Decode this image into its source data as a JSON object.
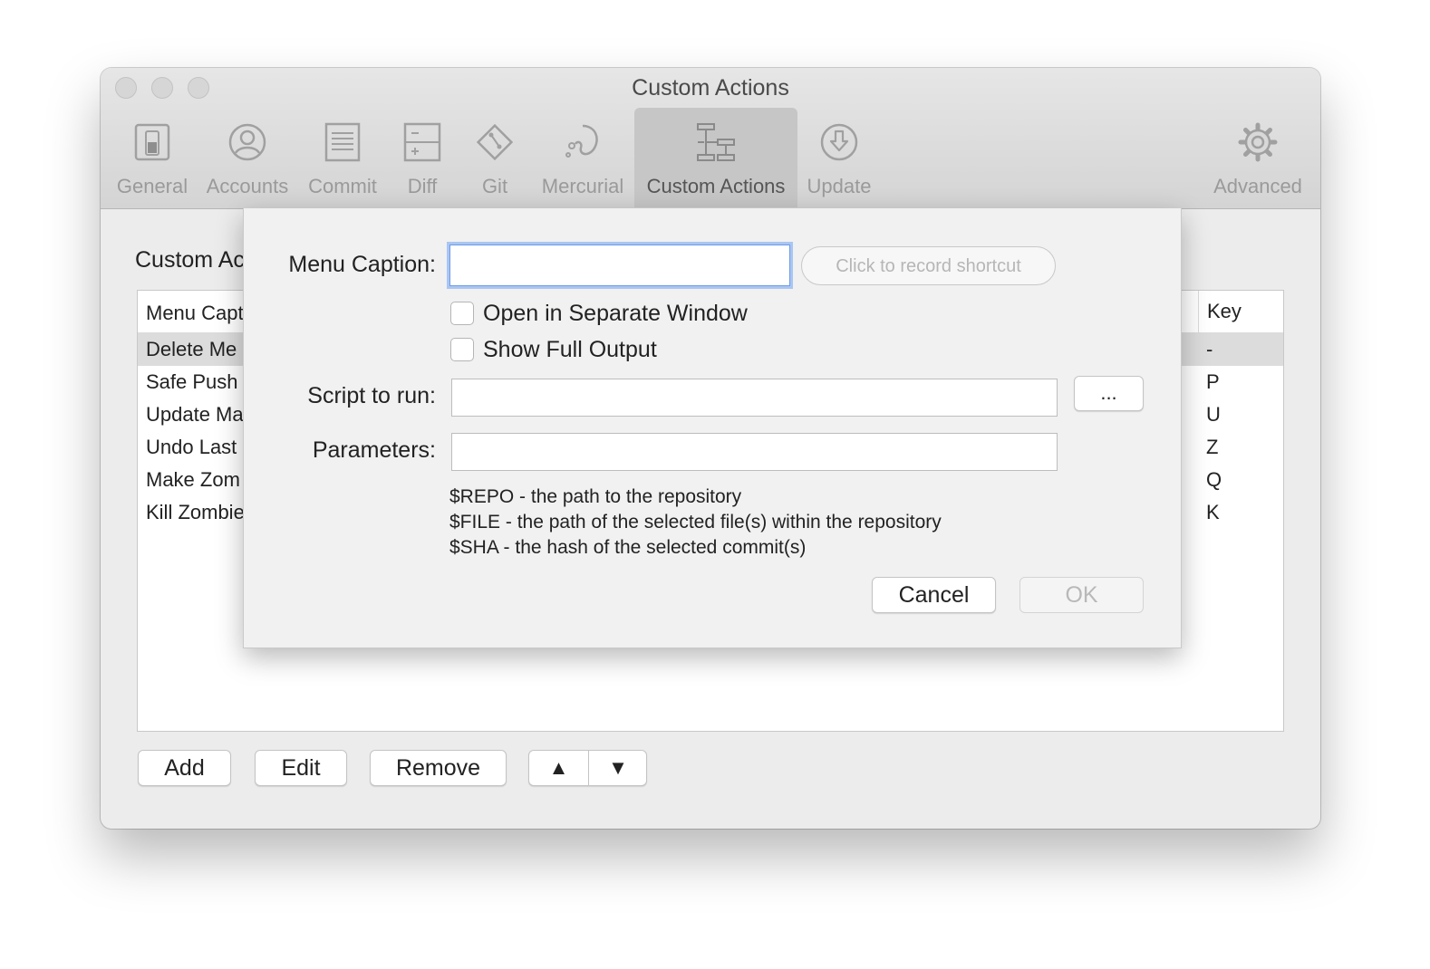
{
  "window": {
    "title": "Custom Actions"
  },
  "toolbar": {
    "tabs": [
      {
        "label": "General",
        "icon": "switch-icon"
      },
      {
        "label": "Accounts",
        "icon": "user-icon"
      },
      {
        "label": "Commit",
        "icon": "document-icon"
      },
      {
        "label": "Diff",
        "icon": "diff-icon"
      },
      {
        "label": "Git",
        "icon": "git-icon"
      },
      {
        "label": "Mercurial",
        "icon": "mercurial-icon"
      },
      {
        "label": "Custom Actions",
        "icon": "hierarchy-icon",
        "active": true
      },
      {
        "label": "Update",
        "icon": "download-icon"
      },
      {
        "label": "Advanced",
        "icon": "gear-icon"
      }
    ]
  },
  "content": {
    "title": "Custom Ac",
    "table": {
      "headers": [
        "Menu Capt",
        "Key"
      ],
      "rows": [
        {
          "caption": "Delete Me",
          "key": "-",
          "selected": true
        },
        {
          "caption": "Safe Push",
          "key": "P"
        },
        {
          "caption": "Update Ma",
          "key": "U"
        },
        {
          "caption": "Undo Last",
          "key": "Z"
        },
        {
          "caption": "Make Zom",
          "key": "Q"
        },
        {
          "caption": "Kill Zombie",
          "key": "K"
        }
      ]
    },
    "buttons": {
      "add": "Add",
      "edit": "Edit",
      "remove": "Remove",
      "up": "▲",
      "down": "▼"
    }
  },
  "sheet": {
    "menu_caption_label": "Menu Caption:",
    "menu_caption_value": "",
    "shortcut_placeholder": "Click to record shortcut",
    "open_separate_label": "Open in Separate Window",
    "show_full_output_label": "Show Full Output",
    "script_label": "Script to run:",
    "script_value": "",
    "browse_label": "...",
    "parameters_label": "Parameters:",
    "parameters_value": "",
    "help": [
      "$REPO - the path to the repository",
      "$FILE - the path of the selected file(s) within the repository",
      "$SHA - the hash of the selected commit(s)"
    ],
    "cancel_label": "Cancel",
    "ok_label": "OK"
  }
}
